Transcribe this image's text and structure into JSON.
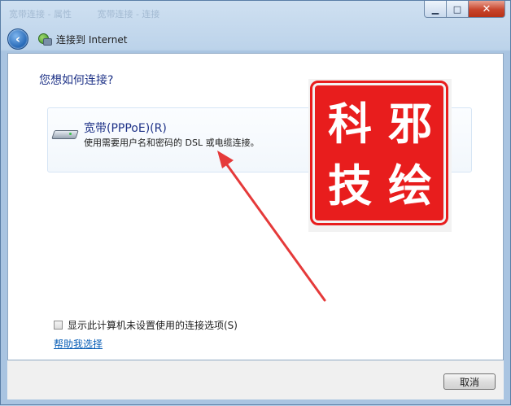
{
  "window": {
    "title_ghost": [
      "宽带连接 - 属性",
      "宽带连接 - 连接"
    ]
  },
  "nav": {
    "back_label": "‹",
    "back_icon": "back-arrow-icon",
    "page_icon": "network-connection-icon",
    "title": "连接到 Internet"
  },
  "main": {
    "question": "您想如何连接?",
    "options": [
      {
        "icon": "broadband-modem-icon",
        "title": "宽带(PPPoE)(R)",
        "description": "使用需要用户名和密码的 DSL 或电缆连接。"
      }
    ],
    "checkbox": {
      "label": "显示此计算机未设置使用的连接选项(S)",
      "checked": false
    },
    "help_link": "帮助我选择"
  },
  "footer": {
    "cancel_label": "取消"
  },
  "overlay": {
    "seal_text": [
      "邪",
      "科",
      "绘",
      "技"
    ],
    "seal_color": "#e81d1d",
    "arrow_color": "#e53a3a"
  },
  "colors": {
    "heading": "#1e3287",
    "link": "#0b5fb7"
  }
}
